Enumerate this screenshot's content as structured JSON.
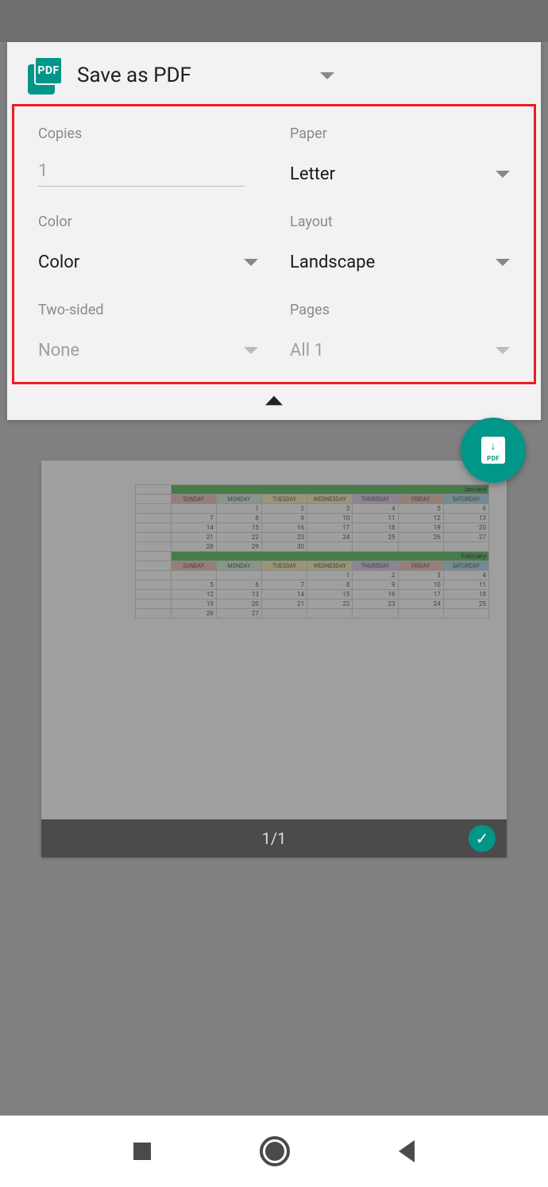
{
  "header": {
    "title": "Save as PDF"
  },
  "options": {
    "copies": {
      "label": "Copies",
      "value": "1"
    },
    "paper": {
      "label": "Paper",
      "value": "Letter"
    },
    "color": {
      "label": "Color",
      "value": "Color"
    },
    "layout": {
      "label": "Layout",
      "value": "Landscape"
    },
    "two_sided": {
      "label": "Two-sided",
      "value": "None"
    },
    "pages": {
      "label": "Pages",
      "value": "All 1"
    }
  },
  "preview": {
    "page_indicator": "1/1"
  },
  "calendar": {
    "months": [
      {
        "name": "January",
        "headers": [
          "SUNDAY",
          "MONDAY",
          "TUESDAY",
          "WEDNESDAY",
          "THURSDAY",
          "FRIDAY",
          "SATURDAY"
        ],
        "rows": [
          [
            "",
            "1",
            "2",
            "3",
            "4",
            "5",
            "6"
          ],
          [
            "7",
            "8",
            "9",
            "10",
            "11",
            "12",
            "13"
          ],
          [
            "14",
            "15",
            "16",
            "17",
            "18",
            "19",
            "20"
          ],
          [
            "21",
            "22",
            "23",
            "24",
            "25",
            "26",
            "27"
          ],
          [
            "28",
            "29",
            "30",
            "",
            "",
            "",
            ""
          ]
        ]
      },
      {
        "name": "February",
        "headers": [
          "SUNDAY",
          "MONDAY",
          "TUESDAY",
          "WEDNESDAY",
          "THURSDAY",
          "FRIDAY",
          "SATURDAY"
        ],
        "rows": [
          [
            "",
            "",
            "",
            "1",
            "2",
            "3",
            "4"
          ],
          [
            "5",
            "6",
            "7",
            "8",
            "9",
            "10",
            "11"
          ],
          [
            "12",
            "13",
            "14",
            "15",
            "16",
            "17",
            "18"
          ],
          [
            "19",
            "20",
            "21",
            "22",
            "23",
            "24",
            "25"
          ],
          [
            "26",
            "27",
            "",
            "",
            "",
            "",
            ""
          ]
        ]
      }
    ]
  }
}
